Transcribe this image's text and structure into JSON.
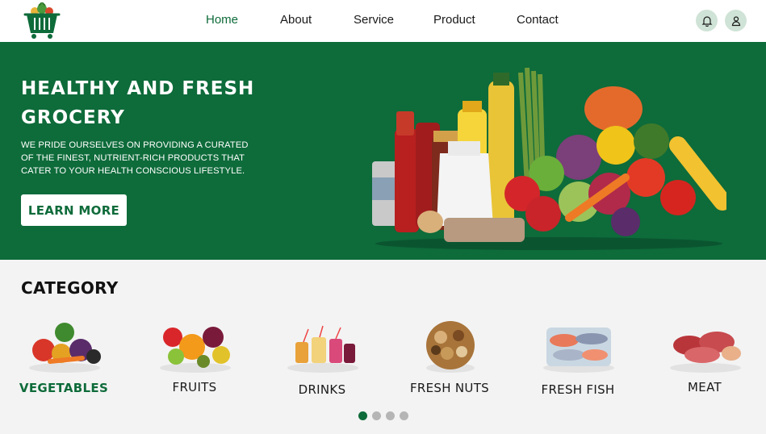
{
  "logo": {
    "icon": "grocery-basket-icon"
  },
  "nav": {
    "items": [
      {
        "label": "Home",
        "active": true
      },
      {
        "label": "About",
        "active": false
      },
      {
        "label": "Service",
        "active": false
      },
      {
        "label": "Product",
        "active": false
      },
      {
        "label": "Contact",
        "active": false
      }
    ]
  },
  "header_icons": {
    "notification": "bell-icon",
    "profile": "user-icon"
  },
  "hero": {
    "title_line1": "HEALTHY AND FRESH",
    "title_line2": "GROCERY",
    "description": "WE PRIDE OURSELVES ON PROVIDING A CURATED OF THE FINEST, NUTRIENT-RICH PRODUCTS THAT CATER TO YOUR HEALTH CONSCIOUS LIFESTYLE.",
    "button_label": "LEARN MORE",
    "image": "groceries-assortment-image"
  },
  "category": {
    "title": "CATEGORY",
    "items": [
      {
        "label": "VEGETABLES",
        "image": "vegetables-image",
        "active": true
      },
      {
        "label": "FRUITS",
        "image": "fruits-image",
        "active": false
      },
      {
        "label": "DRINKS",
        "image": "drinks-image",
        "active": false
      },
      {
        "label": "FRESH NUTS",
        "image": "nuts-image",
        "active": false
      },
      {
        "label": "FRESH FISH",
        "image": "fish-image",
        "active": false
      },
      {
        "label": "MEAT",
        "image": "meat-image",
        "active": false
      }
    ]
  },
  "carousel": {
    "pages": 4,
    "active_page": 1
  },
  "colors": {
    "brand_green": "#0e6b3a",
    "icon_bg": "#cfe3d6",
    "section_bg": "#f3f3f3",
    "dot_inactive": "#b5b5b5"
  }
}
